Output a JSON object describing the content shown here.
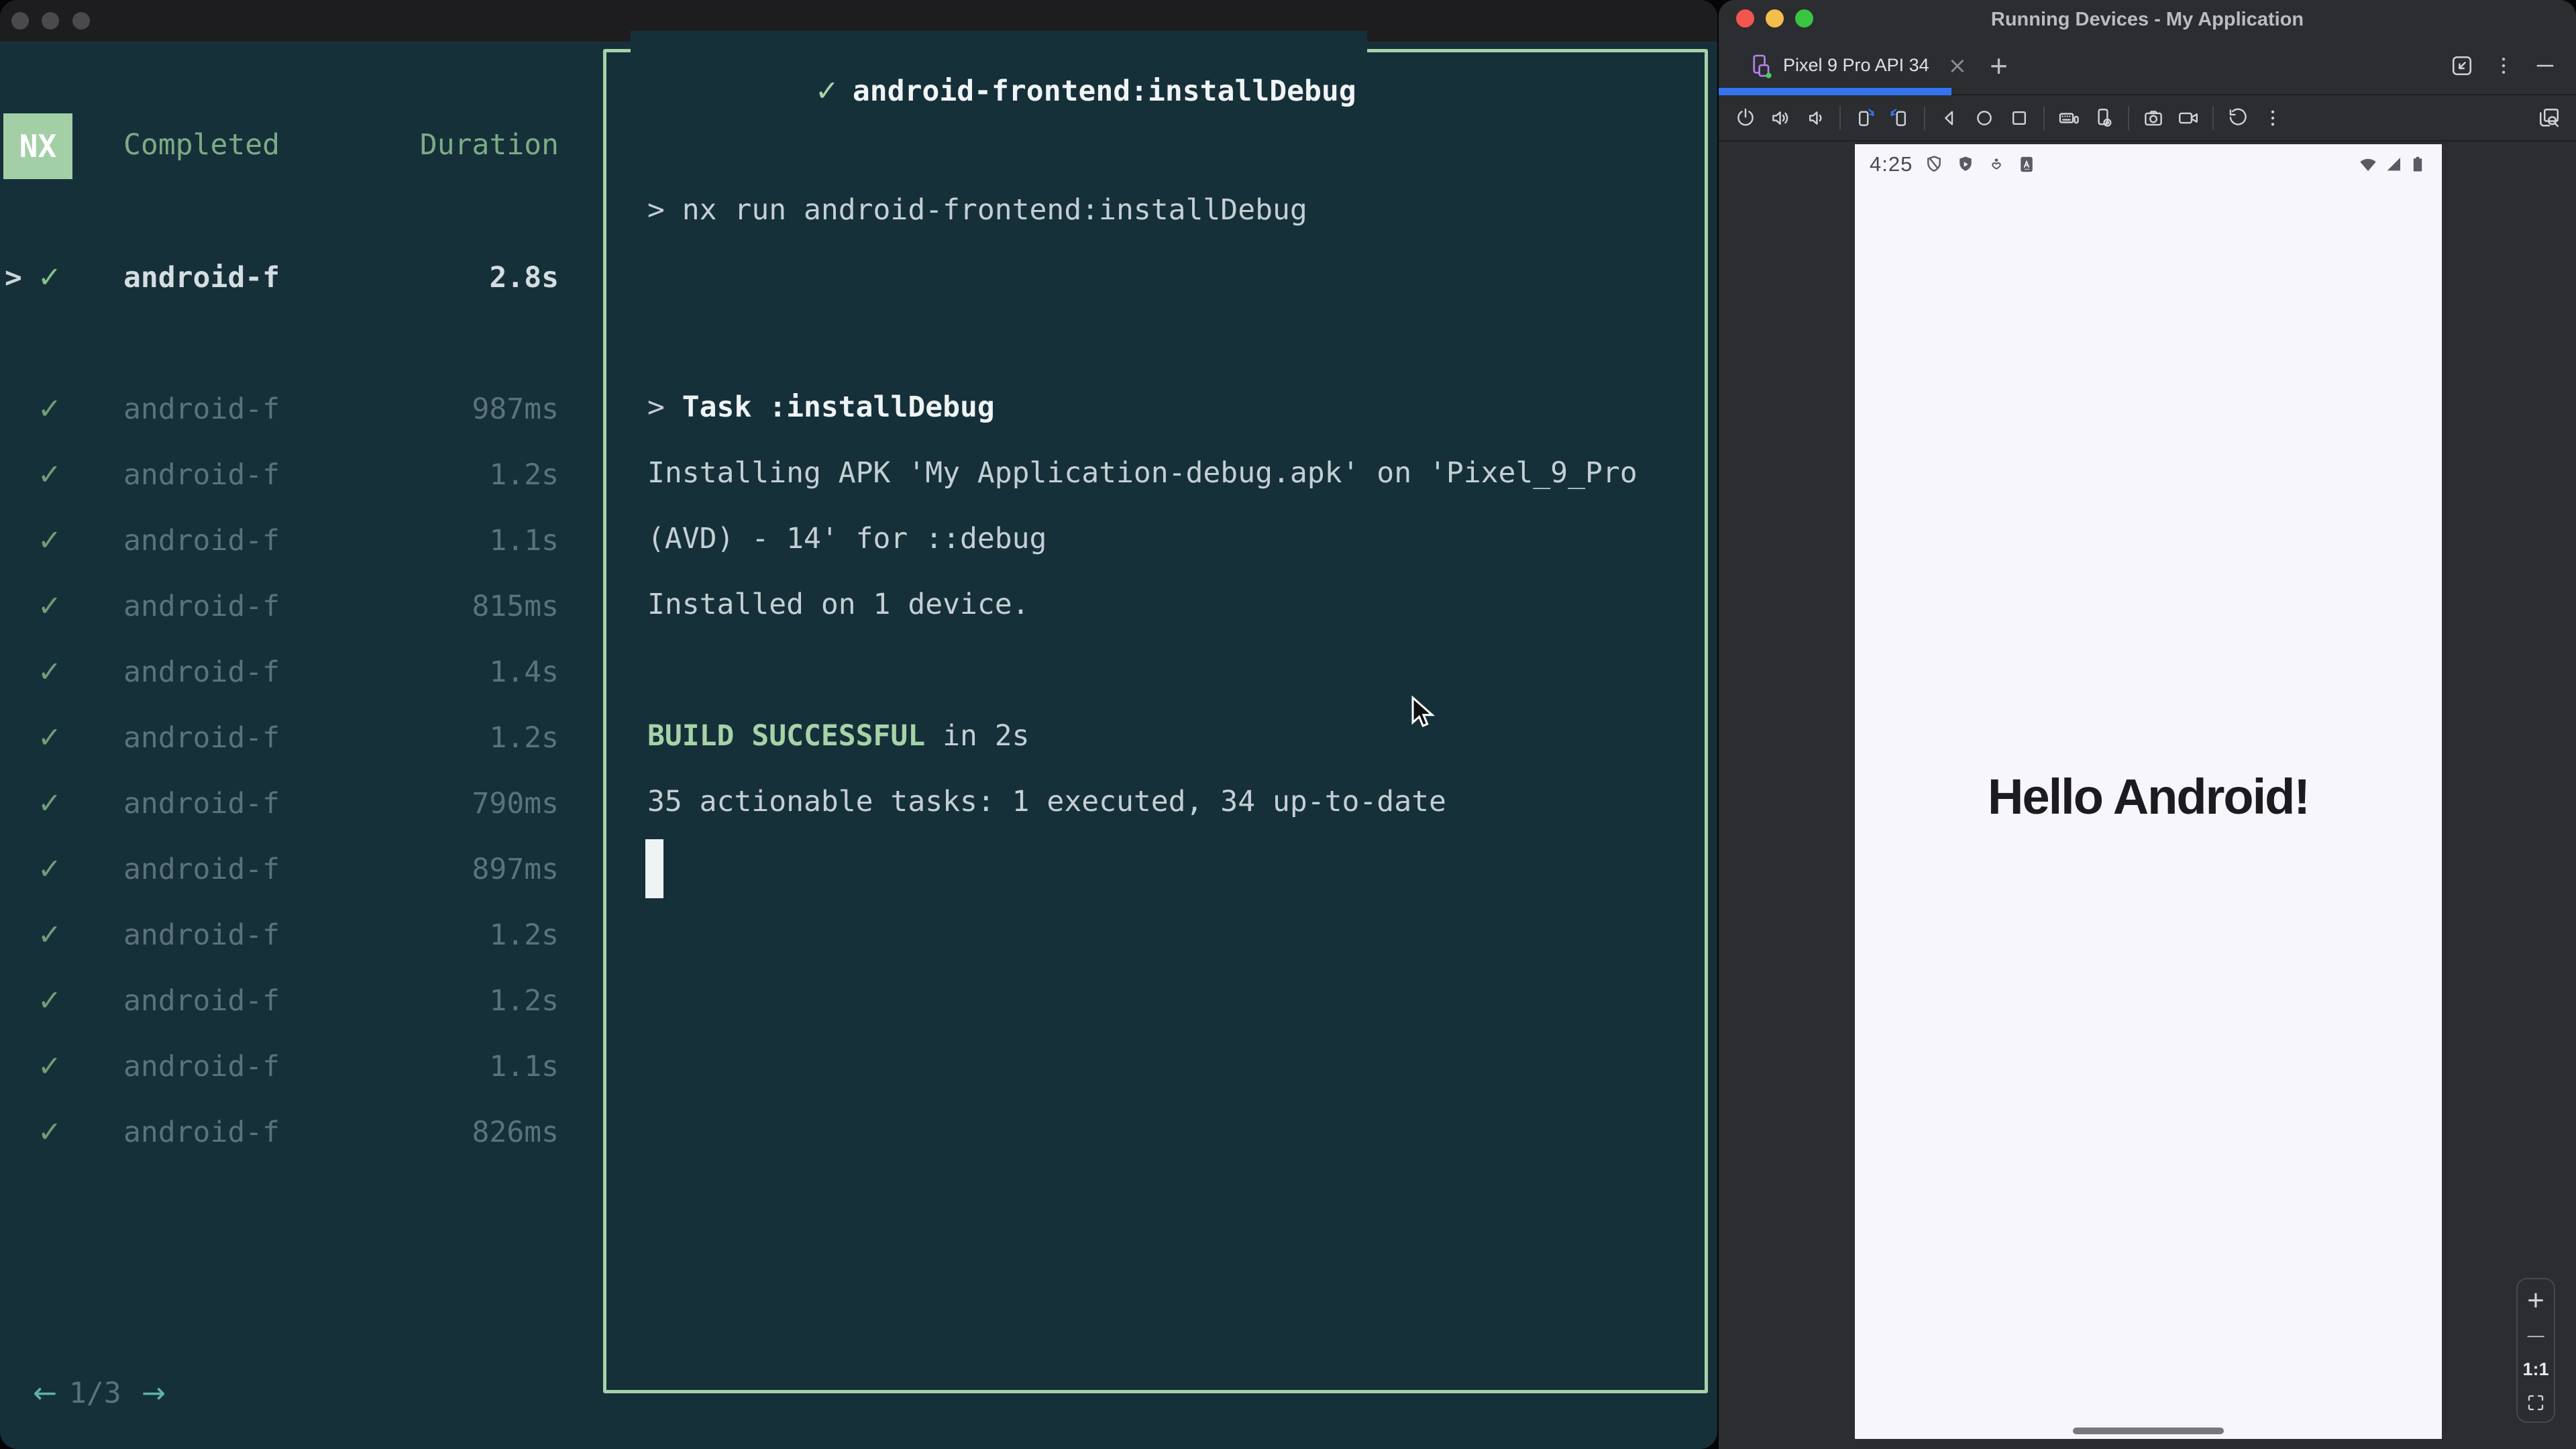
{
  "colors": {
    "terminal_bg": "#16303a",
    "accent_green": "#a5d3a7",
    "muted_green": "#7dab85",
    "dim_text": "#5c727b",
    "output_text": "#c4cfd3",
    "teal_accent": "#63b0a9",
    "studio_bg": "#2b2d30",
    "tab_accent_blue": "#3574f0",
    "device_icon_purple": "#b481ea",
    "device_online_green": "#43d05c",
    "screen_bg": "#f7f6fb",
    "screen_text": "#1d1b20"
  },
  "terminal": {
    "sidebar": {
      "logo": "NX",
      "columns": {
        "completed": "Completed",
        "duration": "Duration"
      },
      "selected_task": {
        "chevron": ">",
        "check": "✓",
        "name": "android-f",
        "duration": "2.8s"
      },
      "tasks": [
        {
          "check": "✓",
          "name": "android-f",
          "duration": "987ms"
        },
        {
          "check": "✓",
          "name": "android-f",
          "duration": "1.2s"
        },
        {
          "check": "✓",
          "name": "android-f",
          "duration": "1.1s"
        },
        {
          "check": "✓",
          "name": "android-f",
          "duration": "815ms"
        },
        {
          "check": "✓",
          "name": "android-f",
          "duration": "1.4s"
        },
        {
          "check": "✓",
          "name": "android-f",
          "duration": "1.2s"
        },
        {
          "check": "✓",
          "name": "android-f",
          "duration": "790ms"
        },
        {
          "check": "✓",
          "name": "android-f",
          "duration": "897ms"
        },
        {
          "check": "✓",
          "name": "android-f",
          "duration": "1.2s"
        },
        {
          "check": "✓",
          "name": "android-f",
          "duration": "1.2s"
        },
        {
          "check": "✓",
          "name": "android-f",
          "duration": "1.1s"
        },
        {
          "check": "✓",
          "name": "android-f",
          "duration": "826ms"
        }
      ],
      "pagination": {
        "prev": "←",
        "current": "1/3",
        "next": "→"
      }
    },
    "output": {
      "check": "✓",
      "title": "android-frontend:installDebug",
      "command": "> nx run android-frontend:installDebug",
      "task_prefix": "> ",
      "task_name": "Task :installDebug",
      "install_line1": "Installing APK 'My Application-debug.apk' on 'Pixel_9_Pro",
      "install_line2": "(AVD) - 14' for ::debug",
      "install_line3": "Installed on 1 device.",
      "build_status": "BUILD SUCCESSFUL",
      "build_suffix": " in 2s",
      "summary": "35 actionable tasks: 1 executed, 34 up-to-date"
    }
  },
  "studio": {
    "title": "Running Devices - My Application",
    "tab_bar": {
      "device_tab": "Pixel 9 Pro API 34",
      "close": "×",
      "new_tab": "+"
    },
    "toolbar_icons": [
      "power",
      "volume-up",
      "volume-down",
      "rotate-left",
      "rotate-right",
      "back",
      "home",
      "overview",
      "keyboard-input",
      "device-settings",
      "camera-snapshot",
      "screen-record",
      "snapshot-reset",
      "more-options",
      "layout-inspector"
    ],
    "window_controls": [
      "embed-window",
      "more-options",
      "hide-panel"
    ],
    "zoom_controls": {
      "zoom_in": "+",
      "zoom_out": "−",
      "actual_size": "1:1"
    },
    "device": {
      "status_time": "4:25",
      "greeting": "Hello Android!"
    }
  }
}
